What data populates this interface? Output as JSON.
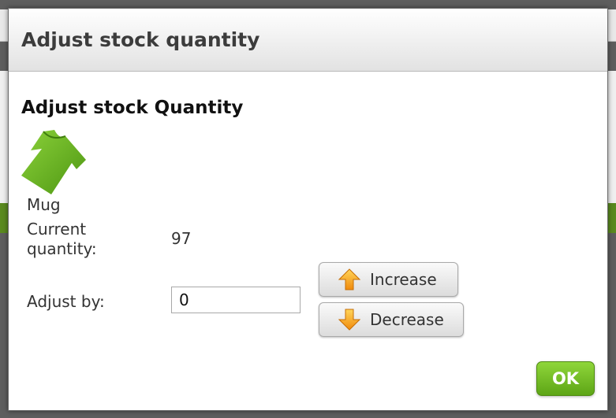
{
  "dialog": {
    "title": "Adjust stock quantity",
    "section_title": "Adjust stock Quantity",
    "product": {
      "name": "Mug",
      "image_icon": "tshirt-icon"
    },
    "current_quantity": {
      "label": "Current quantity:",
      "value": "97"
    },
    "adjust_by": {
      "label": "Adjust by:",
      "value": "0"
    },
    "buttons": {
      "increase": {
        "label": "Increase",
        "icon": "arrow-up-icon"
      },
      "decrease": {
        "label": "Decrease",
        "icon": "arrow-down-icon"
      },
      "ok": "OK"
    }
  },
  "colors": {
    "accent_green": "#6cba1f",
    "arrow_orange": "#f5a41c",
    "overlay": "#5e5e5e"
  }
}
